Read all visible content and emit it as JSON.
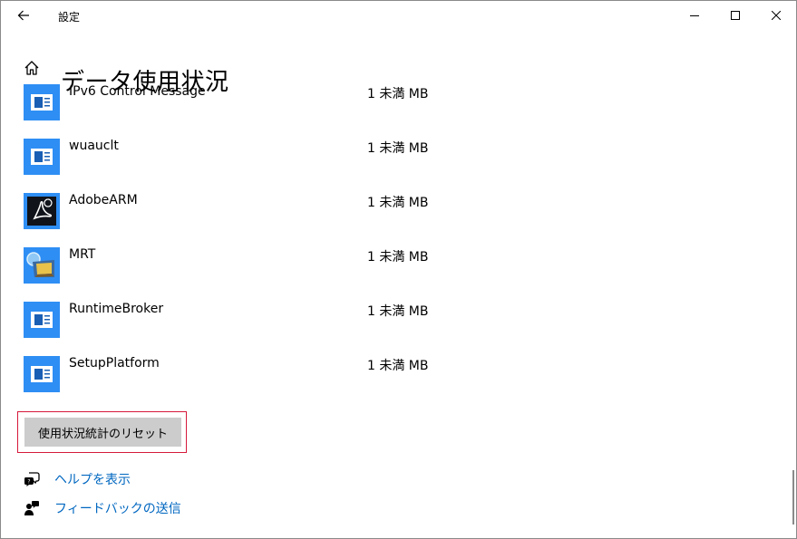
{
  "window": {
    "title": "設定",
    "back_icon": "back-arrow-icon",
    "minimize_icon": "minimize-icon",
    "maximize_icon": "maximize-icon",
    "close_icon": "close-icon"
  },
  "header": {
    "home_icon": "home-icon",
    "title": "データ使用状況"
  },
  "apps": [
    {
      "name": "IPv6 Control Message",
      "usage": "1 未満 MB",
      "icon": "generic-app-icon"
    },
    {
      "name": "wuauclt",
      "usage": "1 未満 MB",
      "icon": "generic-app-icon"
    },
    {
      "name": "AdobeARM",
      "usage": "1 未満 MB",
      "icon": "adobe-acrobat-icon"
    },
    {
      "name": "MRT",
      "usage": "1 未満 MB",
      "icon": "mrt-icon"
    },
    {
      "name": "RuntimeBroker",
      "usage": "1 未満 MB",
      "icon": "generic-app-icon"
    },
    {
      "name": "SetupPlatform",
      "usage": "1 未満 MB",
      "icon": "generic-app-icon"
    }
  ],
  "reset_button": {
    "label": "使用状況統計のリセット"
  },
  "links": {
    "help": {
      "label": "ヘルプを表示",
      "icon": "help-chat-icon"
    },
    "feedback": {
      "label": "フィードバックの送信",
      "icon": "feedback-person-icon"
    }
  },
  "colors": {
    "accent": "#0067c0",
    "app_tile": "#2e8ef4",
    "highlight_border": "#d6193b",
    "button_bg": "#cccccc"
  }
}
